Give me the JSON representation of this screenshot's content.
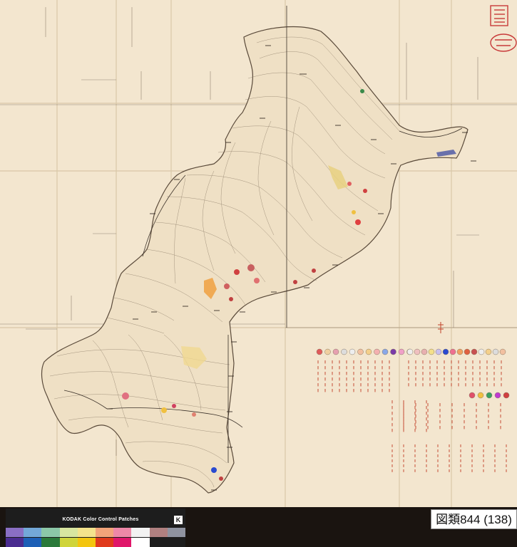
{
  "map": {
    "catalog_label": "図類844 (138)"
  },
  "kodak_strip": {
    "title": "KODAK Color Control Patches",
    "logo_glyph": "K",
    "row1_colors": [
      "#8a6fc4",
      "#73a8d8",
      "#8cc8a8",
      "#d8e6a0",
      "#f4e38c",
      "#f2a47a",
      "#ee88a8",
      "#f2f2f2",
      "#b08080",
      "#8f93a0"
    ],
    "row2_colors": [
      "#4a2c90",
      "#1d5fb6",
      "#2a7a3a",
      "#cfd43a",
      "#f3c50e",
      "#e03a1c",
      "#e0166a",
      "#ffffff",
      "#1d1d1d",
      "#1d1d1d"
    ]
  },
  "colors": {
    "paper": "#f3e6cf",
    "fold": "#d9c7a8",
    "contour": "#8a7a66",
    "coast": "#5a4a3a",
    "stamp": "#c83a3a",
    "legend_red": "#c2422a"
  },
  "legend": {
    "swatch_row_1": [
      "#e05a5a",
      "#f0d0a0",
      "#e6a0b0",
      "#ddd",
      "#eee",
      "#f2c0a0",
      "#f4d08a",
      "#f4b0b0",
      "#8aa8e8",
      "#7a3aa8",
      "#f0a0c8",
      "#ddd"
    ],
    "swatch_row_2": [
      "#eee",
      "#f0c0c0",
      "#e8b0b0",
      "#f4e08a",
      "#c8c0f0",
      "#2a4ad0",
      "#ee7090",
      "#f0a060",
      "#e06040",
      "#c85050",
      "#eee",
      "#f4d08a",
      "#ddd",
      "#f2c0a0"
    ],
    "swatch_row_3": [
      "#e0506a",
      "#f0c040",
      "#3aa060",
      "#c03ad0",
      "#d04040"
    ]
  }
}
